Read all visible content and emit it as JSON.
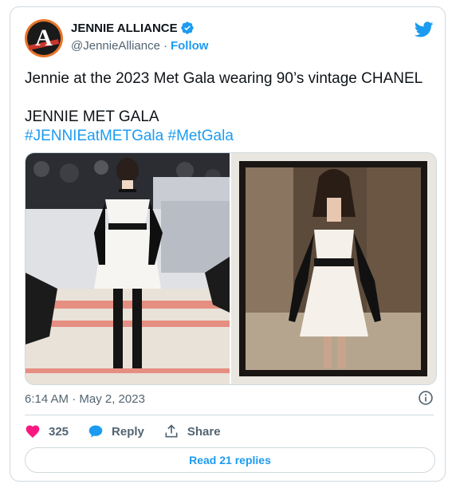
{
  "author": {
    "display_name": "JENNIE ALLIANCE",
    "handle": "@JennieAlliance",
    "separator": "·",
    "follow_label": "Follow",
    "verified": true,
    "avatar_letter": "A"
  },
  "tweet": {
    "line1": "Jennie at the 2023 Met Gala wearing 90’s vintage CHANEL",
    "line2": "JENNIE MET GALA",
    "hashtags": [
      "#JENNIEatMETGala",
      "#MetGala"
    ]
  },
  "media": {
    "photos": [
      {
        "icon": "photo-red-carpet"
      },
      {
        "icon": "photo-vintage-runway"
      }
    ]
  },
  "meta": {
    "timestamp": "6:14 AM · May 2, 2023"
  },
  "actions": {
    "like_count": "325",
    "reply_label": "Reply",
    "share_label": "Share"
  },
  "footer": {
    "read_replies_label": "Read 21 replies"
  },
  "colors": {
    "accent": "#1d9bf0",
    "like": "#f91880",
    "text": "#0f1419",
    "muted": "#536471",
    "border": "#cfd9de"
  }
}
